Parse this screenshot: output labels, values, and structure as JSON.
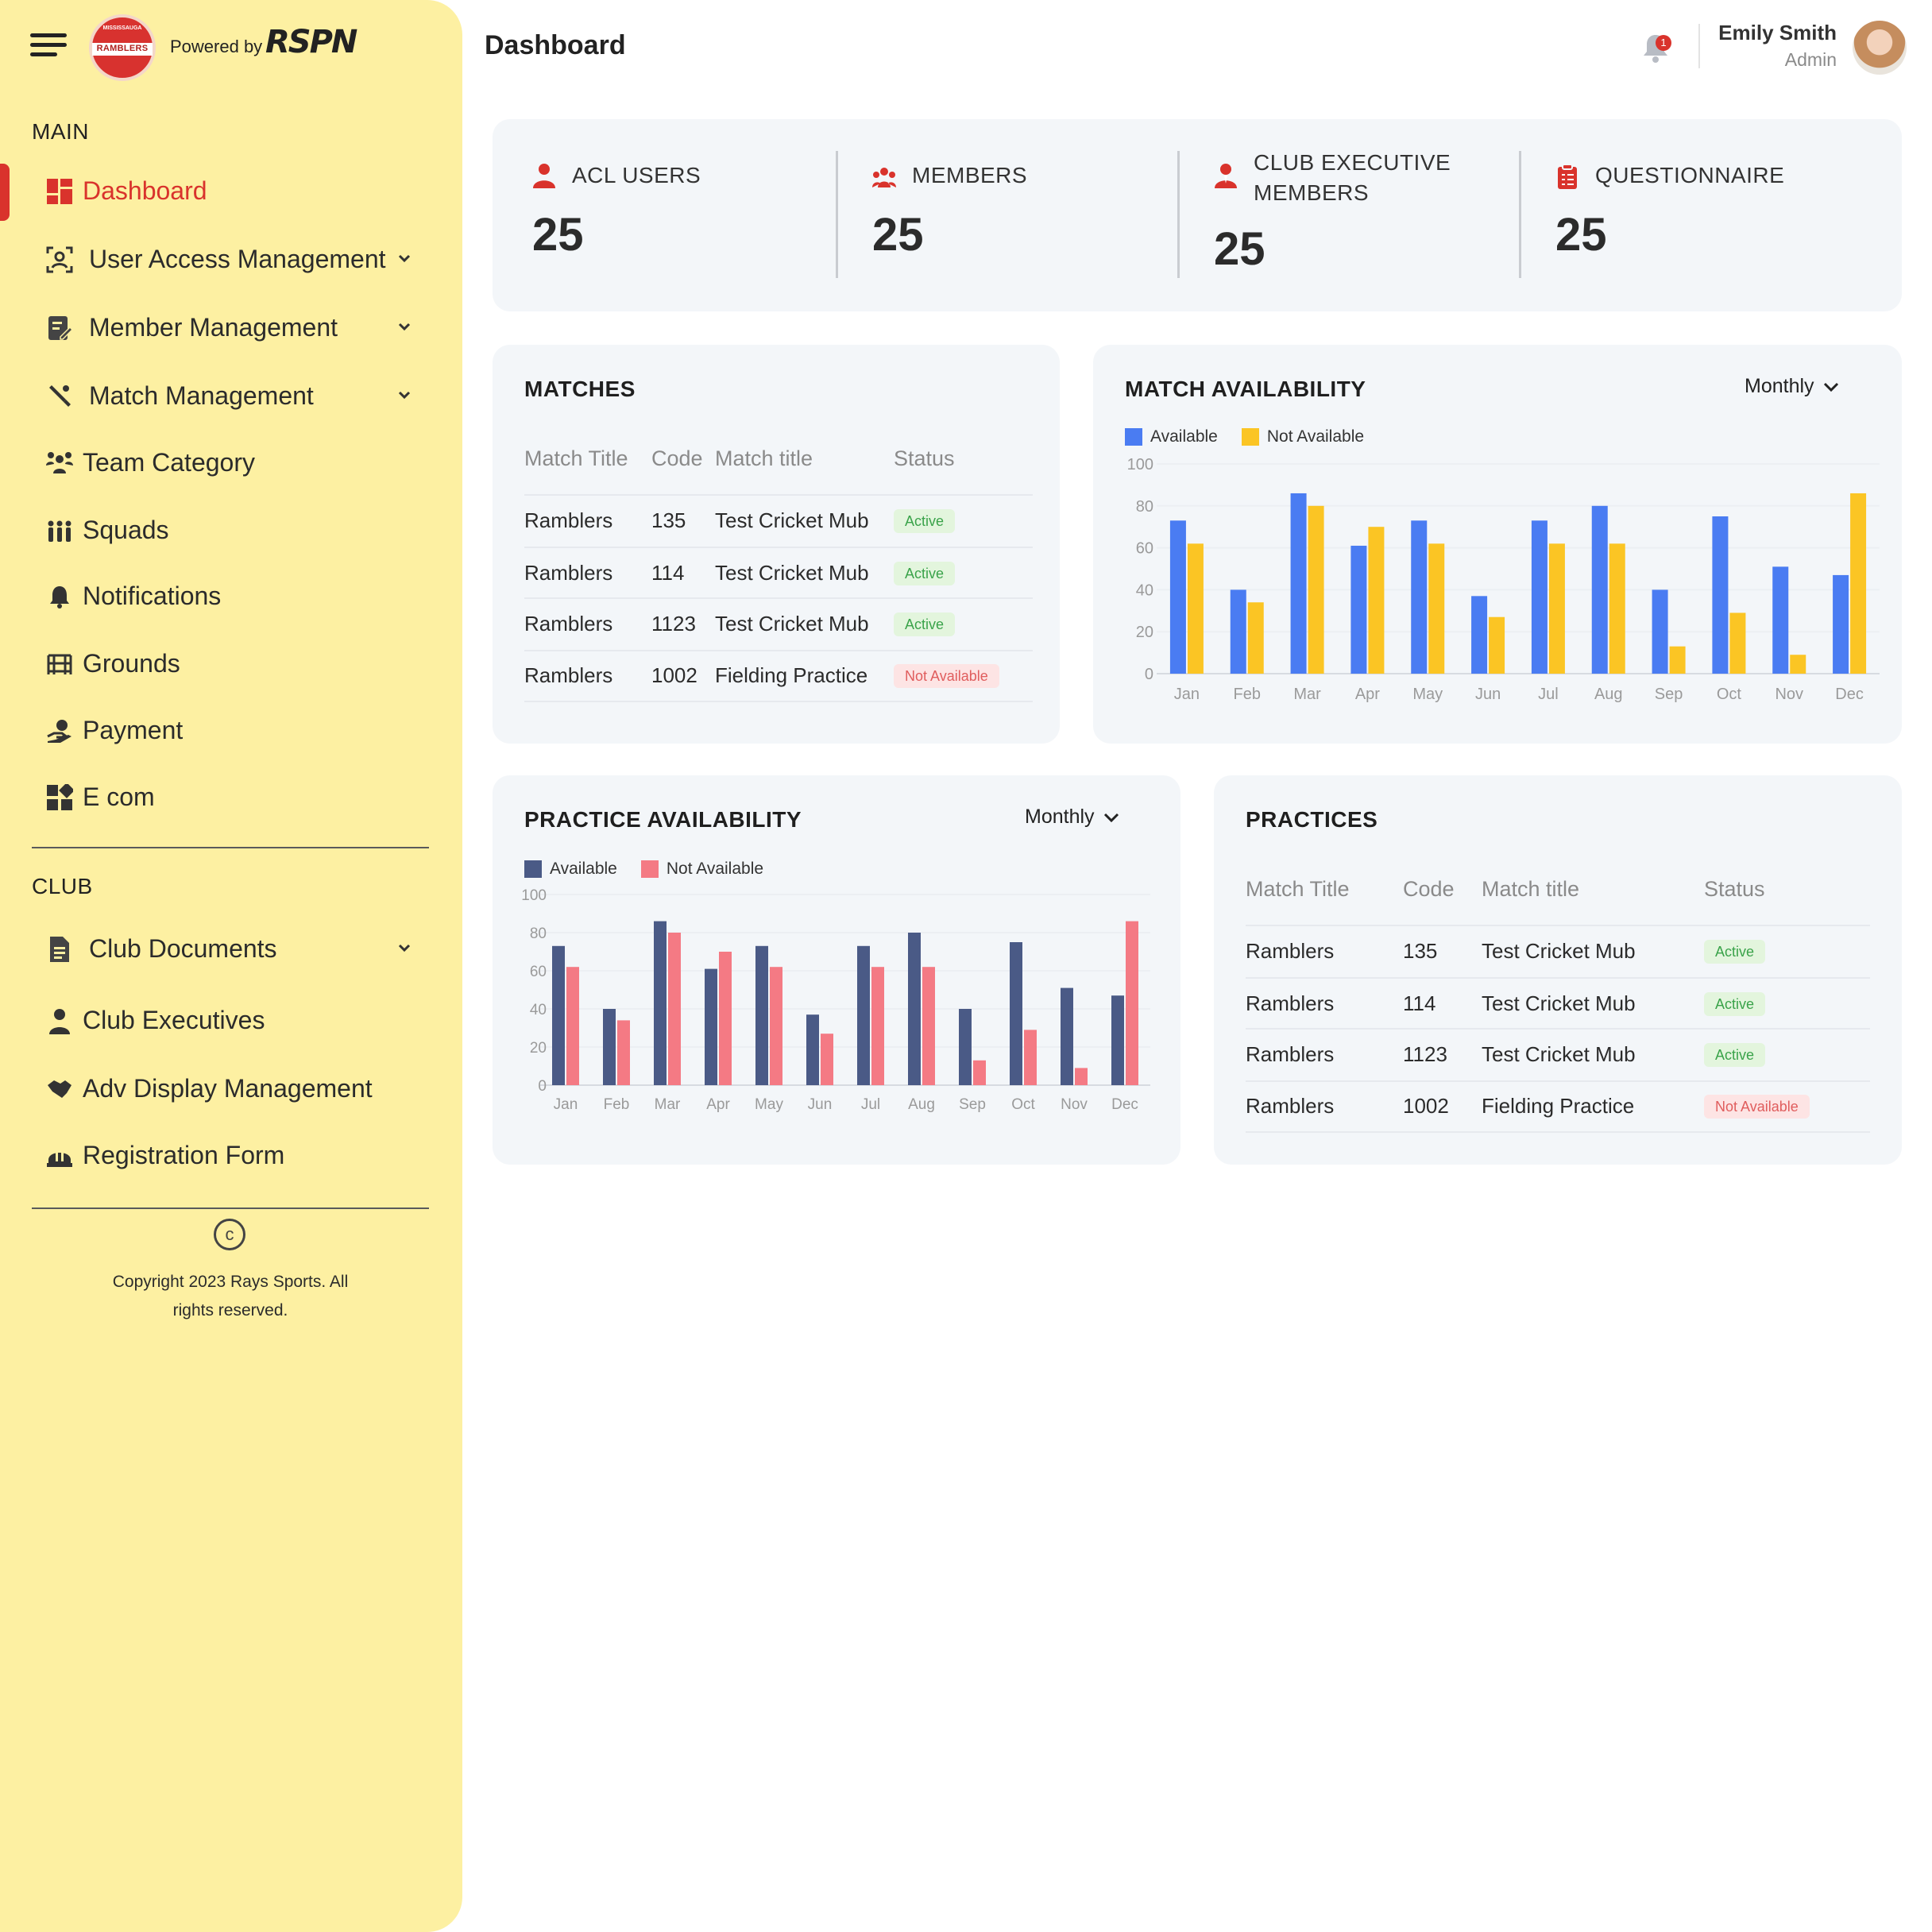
{
  "brand": {
    "logo_text": "RAMBLERS",
    "logo_arc_text": "MISSISSAUGA",
    "powered_by": "Powered by",
    "powered_logo": "RSPN"
  },
  "sidebar": {
    "main_label": "MAIN",
    "club_label": "CLUB",
    "main_items": [
      {
        "label": "Dashboard",
        "icon": "dashboard-icon"
      },
      {
        "label": "User Access Management",
        "icon": "user-access-icon"
      },
      {
        "label": "Member Management",
        "icon": "member-management-icon"
      },
      {
        "label": "Match Management",
        "icon": "cricket-bat-icon"
      },
      {
        "label": "Team Category",
        "icon": "team-category-icon"
      },
      {
        "label": "Squads",
        "icon": "squads-icon"
      },
      {
        "label": "Notifications",
        "icon": "bell-icon"
      },
      {
        "label": "Grounds",
        "icon": "grounds-icon"
      },
      {
        "label": "Payment",
        "icon": "payment-icon"
      },
      {
        "label": "E com",
        "icon": "ecom-icon"
      }
    ],
    "club_items": [
      {
        "label": "Club Documents",
        "icon": "document-icon"
      },
      {
        "label": "Club Executives",
        "icon": "executive-icon"
      },
      {
        "label": "Adv Display Management",
        "icon": "handshake-icon"
      },
      {
        "label": "Registration Form",
        "icon": "registration-icon"
      }
    ],
    "copyright_line1": "Copyright 2023 Rays Sports. All",
    "copyright_line2": "rights reserved."
  },
  "header": {
    "title": "Dashboard",
    "notification_count": "1",
    "user_name": "Emily Smith",
    "user_role": "Admin"
  },
  "stats": [
    {
      "label": "ACL USERS",
      "value": "25"
    },
    {
      "label": "MEMBERS",
      "value": "25"
    },
    {
      "label": "CLUB EXECUTIVE",
      "label2": "MEMBERS",
      "value": "25"
    },
    {
      "label": "QUESTIONNAIRE",
      "value": "25"
    }
  ],
  "matches": {
    "title": "MATCHES",
    "headers": [
      "Match Title",
      "Code",
      "Match title",
      "Status"
    ],
    "rows": [
      {
        "title": "Ramblers",
        "code": "135",
        "match": "Test Cricket Mub",
        "status": "Active"
      },
      {
        "title": "Ramblers",
        "code": "114",
        "match": "Test Cricket Mub",
        "status": "Active"
      },
      {
        "title": "Ramblers",
        "code": "1123",
        "match": "Test Cricket Mub",
        "status": "Active"
      },
      {
        "title": "Ramblers",
        "code": "1002",
        "match": "Fielding Practice",
        "status": "Not Available"
      }
    ]
  },
  "practices": {
    "title": "PRACTICES",
    "headers": [
      "Match Title",
      "Code",
      "Match title",
      "Status"
    ],
    "rows": [
      {
        "title": "Ramblers",
        "code": "135",
        "match": "Test Cricket Mub",
        "status": "Active"
      },
      {
        "title": "Ramblers",
        "code": "114",
        "match": "Test Cricket Mub",
        "status": "Active"
      },
      {
        "title": "Ramblers",
        "code": "1123",
        "match": "Test Cricket Mub",
        "status": "Active"
      },
      {
        "title": "Ramblers",
        "code": "1002",
        "match": "Fielding Practice",
        "status": "Not Available"
      }
    ]
  },
  "match_availability": {
    "title": "MATCH AVAILABILITY",
    "period": "Monthly"
  },
  "practice_availability": {
    "title": "PRACTICE AVAILABILITY",
    "period": "Monthly"
  },
  "colors": {
    "sidebar_bg": "#fdf0a2",
    "accent_red": "#d9332c",
    "match_available": "#4a7cf2",
    "match_not_available": "#fbc524",
    "practice_available": "#4a5a86",
    "practice_not_available": "#f47a84"
  },
  "chart_data": [
    {
      "type": "bar",
      "title": "MATCH AVAILABILITY",
      "categories": [
        "Jan",
        "Feb",
        "Mar",
        "Apr",
        "May",
        "Jun",
        "Jul",
        "Aug",
        "Sep",
        "Oct",
        "Nov",
        "Dec"
      ],
      "series": [
        {
          "name": "Available",
          "values": [
            73,
            40,
            86,
            61,
            73,
            37,
            73,
            80,
            40,
            75,
            51,
            47
          ]
        },
        {
          "name": "Not Available",
          "values": [
            62,
            34,
            80,
            70,
            62,
            27,
            62,
            62,
            13,
            29,
            9,
            86
          ]
        }
      ],
      "ylim": [
        0,
        100
      ],
      "yticks": [
        0,
        20,
        40,
        60,
        80,
        100
      ],
      "legend": "top-left",
      "grid": false
    },
    {
      "type": "bar",
      "title": "PRACTICE AVAILABILITY",
      "categories": [
        "Jan",
        "Feb",
        "Mar",
        "Apr",
        "May",
        "Jun",
        "Jul",
        "Aug",
        "Sep",
        "Oct",
        "Nov",
        "Dec"
      ],
      "series": [
        {
          "name": "Available",
          "values": [
            73,
            40,
            86,
            61,
            73,
            37,
            73,
            80,
            40,
            75,
            51,
            47
          ]
        },
        {
          "name": "Not Available",
          "values": [
            62,
            34,
            80,
            70,
            62,
            27,
            62,
            62,
            13,
            29,
            9,
            86
          ]
        }
      ],
      "ylim": [
        0,
        100
      ],
      "yticks": [
        0,
        20,
        40,
        60,
        80,
        100
      ],
      "legend": "top-left",
      "grid": false
    }
  ]
}
